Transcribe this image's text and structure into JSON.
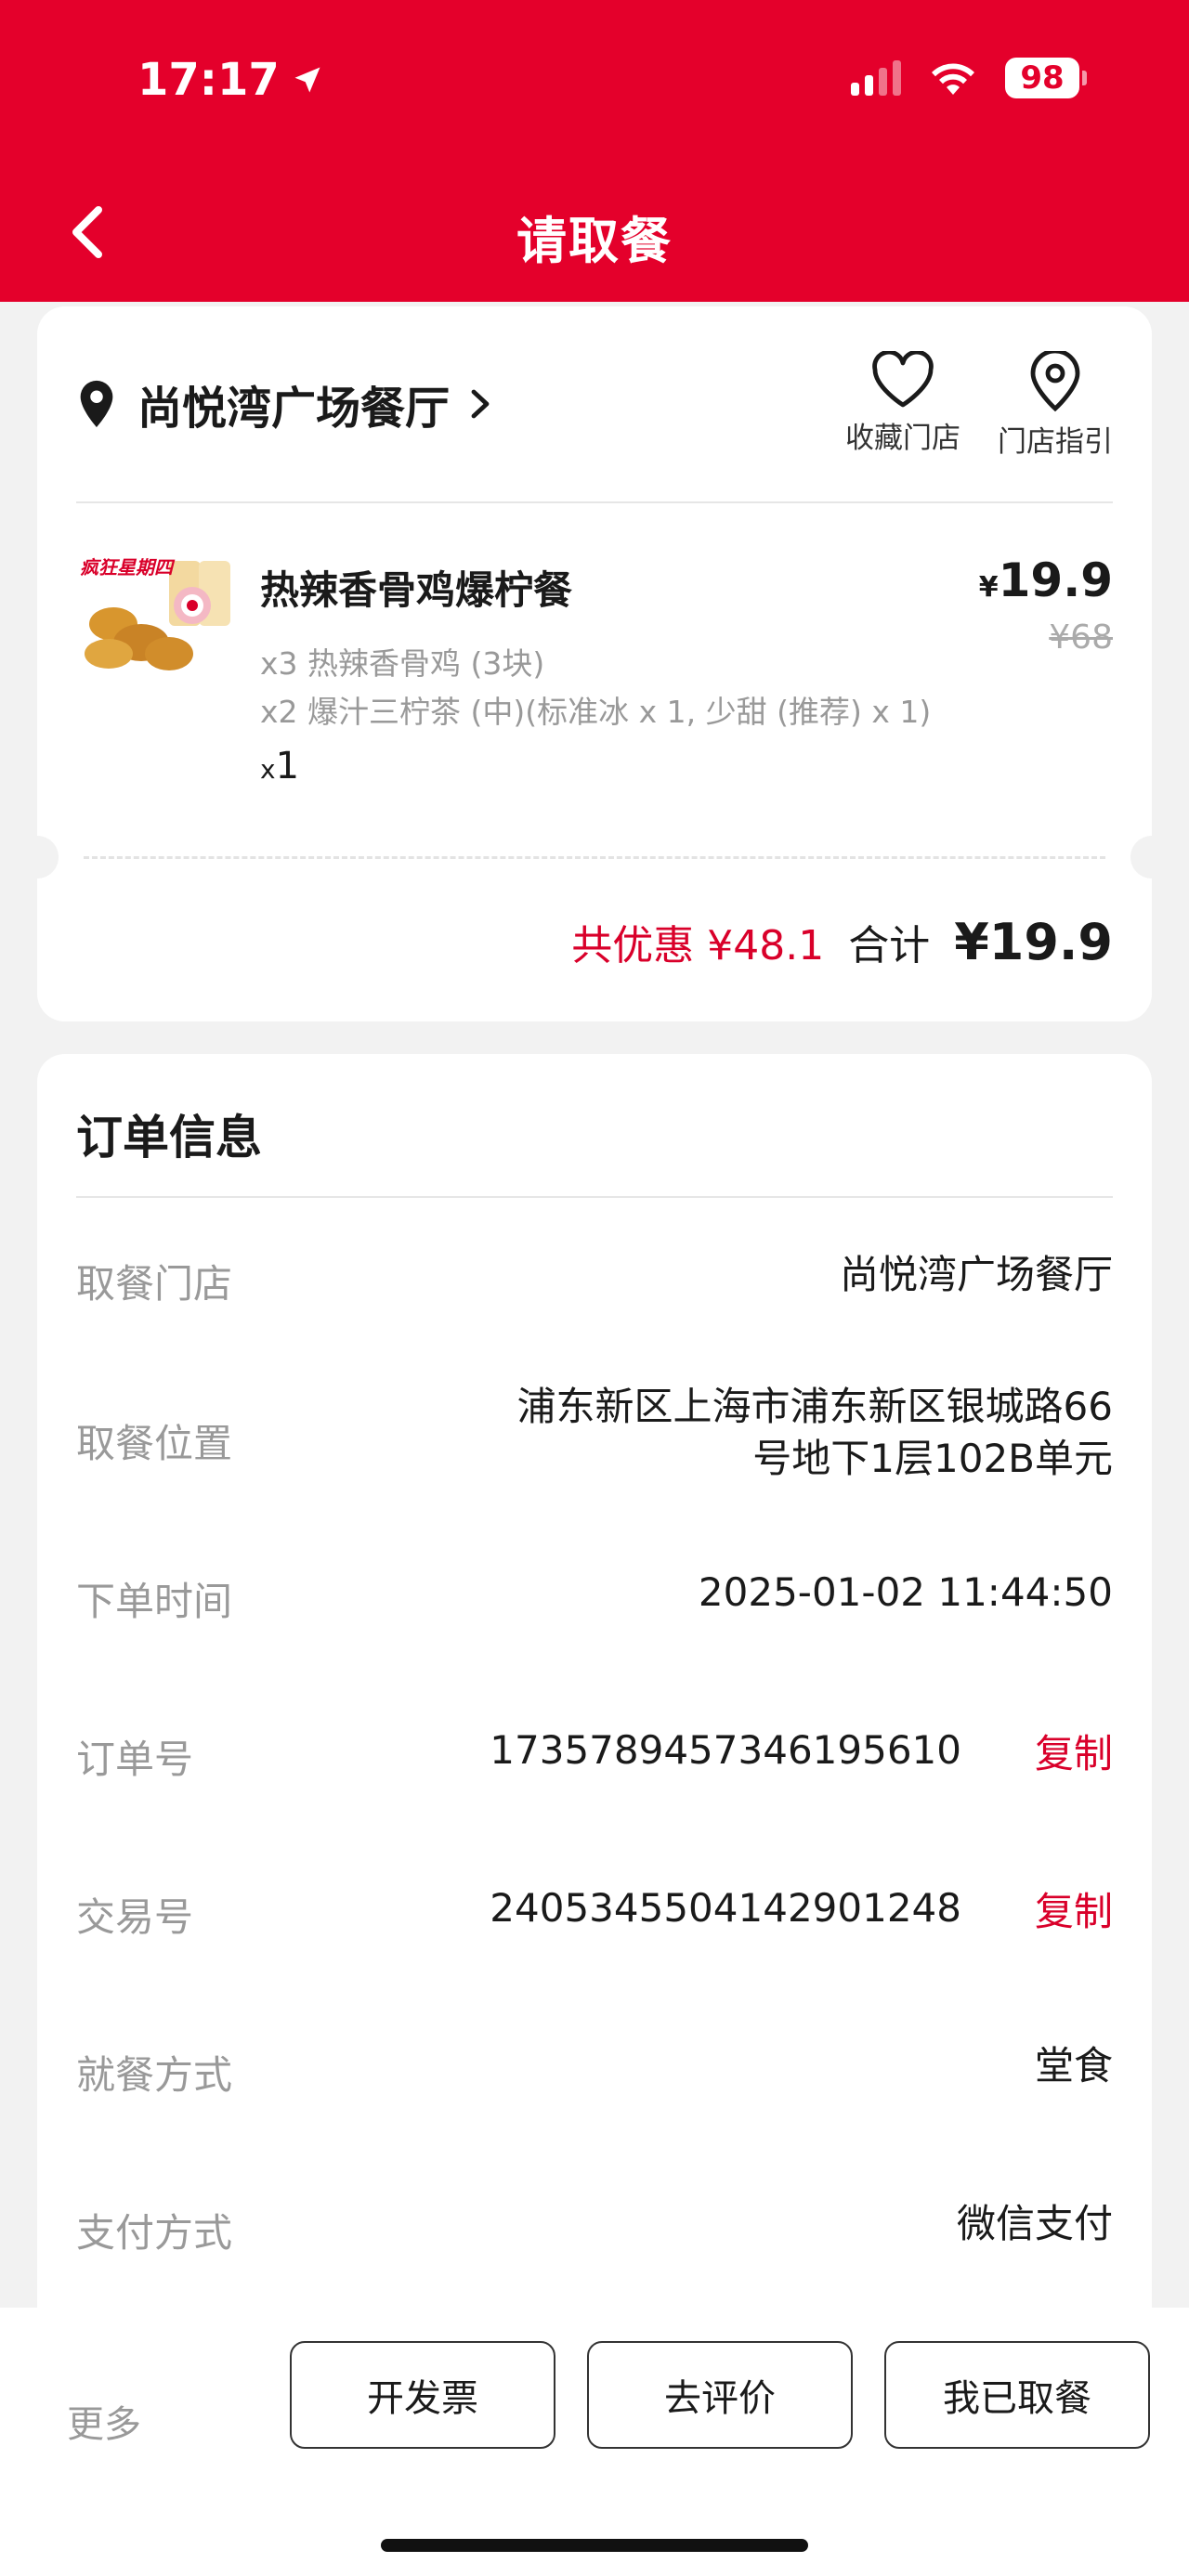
{
  "status_bar": {
    "time": "17:17",
    "battery": "98"
  },
  "header": {
    "title": "请取餐"
  },
  "store": {
    "name": "尚悦湾广场餐厅",
    "favorite_label": "收藏门店",
    "guide_label": "门店指引"
  },
  "order_item": {
    "image_label": "疯狂星期四",
    "name": "热辣香骨鸡爆柠餐",
    "detail_1": "x3 热辣香骨鸡 (3块)",
    "detail_2": "x2 爆汁三柠茶 (中)(标准冰 x 1, 少甜 (推荐) x 1)",
    "qty_prefix": "x",
    "qty": "1",
    "currency": "¥",
    "price": "19.9",
    "original_price": "¥68"
  },
  "summary": {
    "discount": "共优惠 ¥48.1",
    "total_label": "合计",
    "total": "¥19.9"
  },
  "order_info": {
    "title": "订单信息",
    "rows": [
      {
        "label": "取餐门店",
        "value": "尚悦湾广场餐厅"
      },
      {
        "label": "取餐位置",
        "value_line1": "浦东新区上海市浦东新区银城路66",
        "value_line2": "号地下1层102B单元"
      },
      {
        "label": "下单时间",
        "value": "2025-01-02 11:44:50"
      },
      {
        "label": "订单号",
        "value": "1735789457346195610",
        "action": "复制"
      },
      {
        "label": "交易号",
        "value": "2405345504142901248",
        "action": "复制"
      },
      {
        "label": "就餐方式",
        "value": "堂食"
      },
      {
        "label": "支付方式",
        "value": "微信支付"
      }
    ]
  },
  "bottom_bar": {
    "more": "更多",
    "invoice": "开发票",
    "review": "去评价",
    "picked_up": "我已取餐"
  },
  "colors": {
    "brand_red": "#e4002b",
    "accent_red": "#d9002a"
  }
}
